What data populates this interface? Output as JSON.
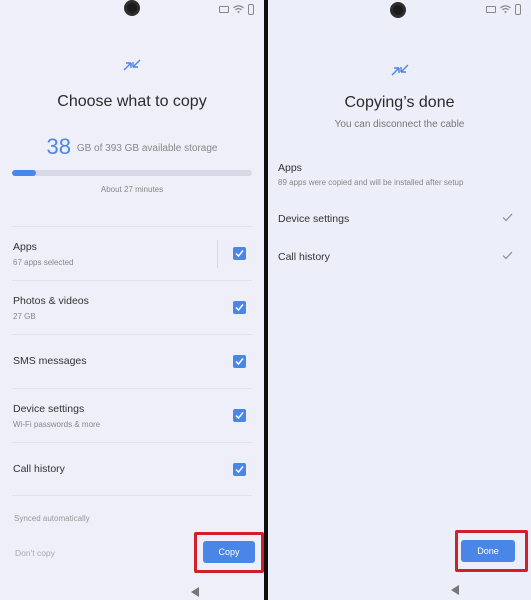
{
  "left_screen": {
    "title": "Choose what to copy",
    "storage": {
      "used": "38",
      "rest": "GB of 393 GB available storage",
      "progress_fraction": 0.1
    },
    "eta": "About 27 minutes",
    "items": [
      {
        "label": "Apps",
        "desc": "67 apps selected",
        "checked": true
      },
      {
        "label": "Photos & videos",
        "desc": "27 GB",
        "checked": true
      },
      {
        "label": "SMS messages",
        "desc": "",
        "checked": true
      },
      {
        "label": "Device settings",
        "desc": "Wi-Fi passwords & more",
        "checked": true
      },
      {
        "label": "Call history",
        "desc": "",
        "checked": true
      }
    ],
    "synced_note": "Synced automatically",
    "dont_copy_label": "Don't copy",
    "copy_label": "Copy"
  },
  "right_screen": {
    "title": "Copying’s done",
    "subtitle": "You can disconnect the cable",
    "items": [
      {
        "label": "Apps",
        "desc": "89 apps were copied and will be installed after setup"
      },
      {
        "label": "Device settings",
        "desc": ""
      },
      {
        "label": "Call history",
        "desc": ""
      }
    ],
    "done_label": "Done"
  },
  "colors": {
    "accent": "#4a86e8",
    "highlight": "#d0202a",
    "background": "#eeeff8"
  },
  "icons": [
    "front-camera-icon",
    "transfer-arrows-icon",
    "checkbox-checked-icon",
    "checkmark-icon",
    "back-nav-icon",
    "wifi-icon",
    "battery-icon"
  ]
}
